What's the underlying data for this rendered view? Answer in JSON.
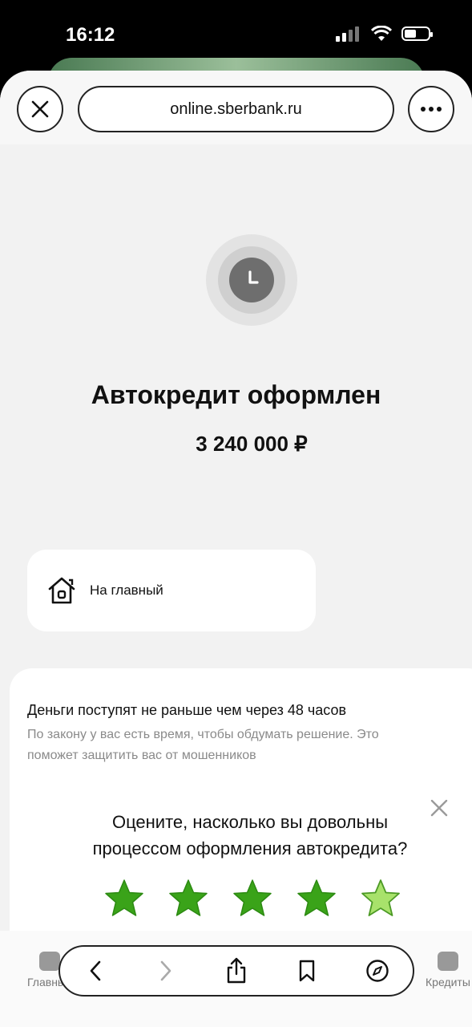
{
  "status_bar": {
    "time": "16:12",
    "icons": [
      "signal-icon",
      "wifi-icon",
      "battery-icon"
    ]
  },
  "browser": {
    "url": "online.sberbank.ru",
    "close_icon": "close-icon",
    "menu_icon": "more-icon"
  },
  "result": {
    "status_icon": "clock-icon",
    "title": "Автокредит оформлен",
    "amount": "3 240 000 ₽"
  },
  "home_button": {
    "label": "На главный",
    "icon": "home-icon"
  },
  "info": {
    "title": "Деньги поступят не раньше чем через 48 часов",
    "subtitle": "По закону у вас есть время, чтобы обдумать решение. Это поможет защитить вас от мошенников"
  },
  "rating": {
    "question": "Оцените, насколько вы довольны процессом оформления автокредита?",
    "stars": 5,
    "colors": {
      "filled": "#3aa319",
      "light": "#a8e26b"
    }
  },
  "tabbar": {
    "items": [
      {
        "label": "Главный"
      },
      {
        "label": "Кредиты"
      }
    ]
  },
  "browser_toolbar": {
    "icons": [
      "back-icon",
      "forward-icon",
      "share-icon",
      "bookmarks-icon",
      "compass-icon"
    ]
  }
}
